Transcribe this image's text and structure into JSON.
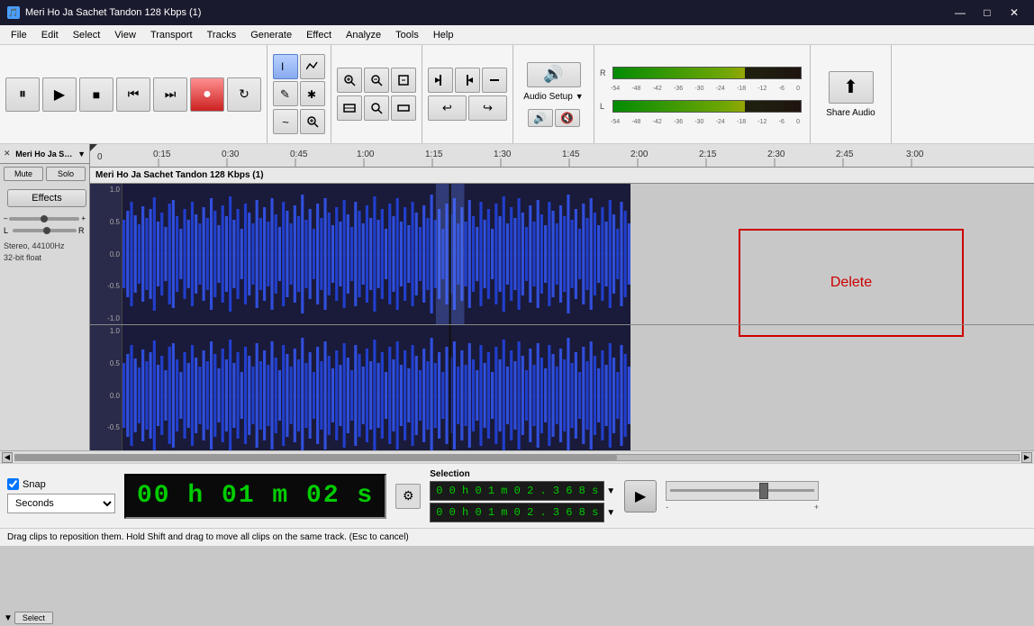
{
  "app": {
    "title": "Meri Ho Ja Sachet Tandon 128 Kbps (1)",
    "icon": "A"
  },
  "titlebar": {
    "controls": {
      "minimize": "—",
      "maximize": "□",
      "close": "✕"
    }
  },
  "menubar": {
    "items": [
      "File",
      "Edit",
      "Select",
      "View",
      "Transport",
      "Tracks",
      "Generate",
      "Effect",
      "Analyze",
      "Tools",
      "Help"
    ]
  },
  "toolbar": {
    "transport": {
      "pause": "⏸",
      "play": "▶",
      "stop": "■",
      "skip_back": "⏮",
      "skip_forward": "⏭",
      "record": "●",
      "loop": "↻"
    },
    "tools": {
      "select": "I",
      "envelope": "∿",
      "draw": "✏",
      "zoom": "✛",
      "multi": "✱",
      "smooth": "~"
    },
    "zoom_controls": {
      "zoom_in": "🔍+",
      "zoom_out": "🔍-",
      "fit_sel": "⊡",
      "fit_project": "⊞",
      "zoom_toggle": "⊟",
      "zoom_width": "⊠"
    },
    "edit_controls": {
      "trim_left": "◁|",
      "trim_right": "|▷",
      "silence": "—",
      "undo": "↩",
      "redo": "↪"
    },
    "audio_setup": {
      "label": "Audio Setup",
      "icon": "🔊"
    },
    "share_audio": {
      "label": "Share Audio",
      "icon": "⬆"
    },
    "vu_labels": [
      "R",
      "L",
      "R"
    ],
    "vu_ticks": [
      "-54",
      "-48",
      "-42",
      "-36",
      "-30",
      "-24",
      "-18",
      "-12",
      "-6",
      "0"
    ]
  },
  "track": {
    "name": "Meri Ho Ja S…",
    "full_name": "Meri Ho Ja Sachet Tandon 128 Kbps (1)",
    "close_icon": "✕",
    "mute_label": "Mute",
    "solo_label": "Solo",
    "effects_label": "Effects",
    "volume_label": "L",
    "volume_r_label": "R",
    "info_line1": "Stereo, 44100Hz",
    "info_line2": "32-bit float",
    "select_label": "Select",
    "expand_icon": "▼"
  },
  "ruler": {
    "ticks": [
      "0",
      "0:15",
      "0:30",
      "0:45",
      "1:00",
      "1:15",
      "1:30",
      "1:45",
      "2:00",
      "2:15",
      "2:30",
      "2:45",
      "3:00"
    ]
  },
  "delete_region": {
    "label": "Delete"
  },
  "bottom_toolbar": {
    "snap": {
      "label": "Snap",
      "checked": true
    },
    "seconds_label": "Seconds",
    "time_display": "00 h 01 m 02 s",
    "selection_label": "Selection",
    "selection_start": "0 0 h 0 1 m 0 2 . 3 6 8 s",
    "selection_end": "0 0 h 0 1 m 0 2 . 3 6 8 s",
    "play_icon": "▶",
    "speed_min": "-",
    "speed_max": "+"
  },
  "statusbar": {
    "message": "Drag clips to reposition them. Hold Shift and drag to move all clips on the same track. (Esc to cancel)"
  },
  "colors": {
    "waveform_blue": "#2244cc",
    "waveform_bg": "#1a1a3a",
    "delete_red": "#cc0000",
    "time_green": "#00cc00",
    "accent": "#0078d7"
  }
}
